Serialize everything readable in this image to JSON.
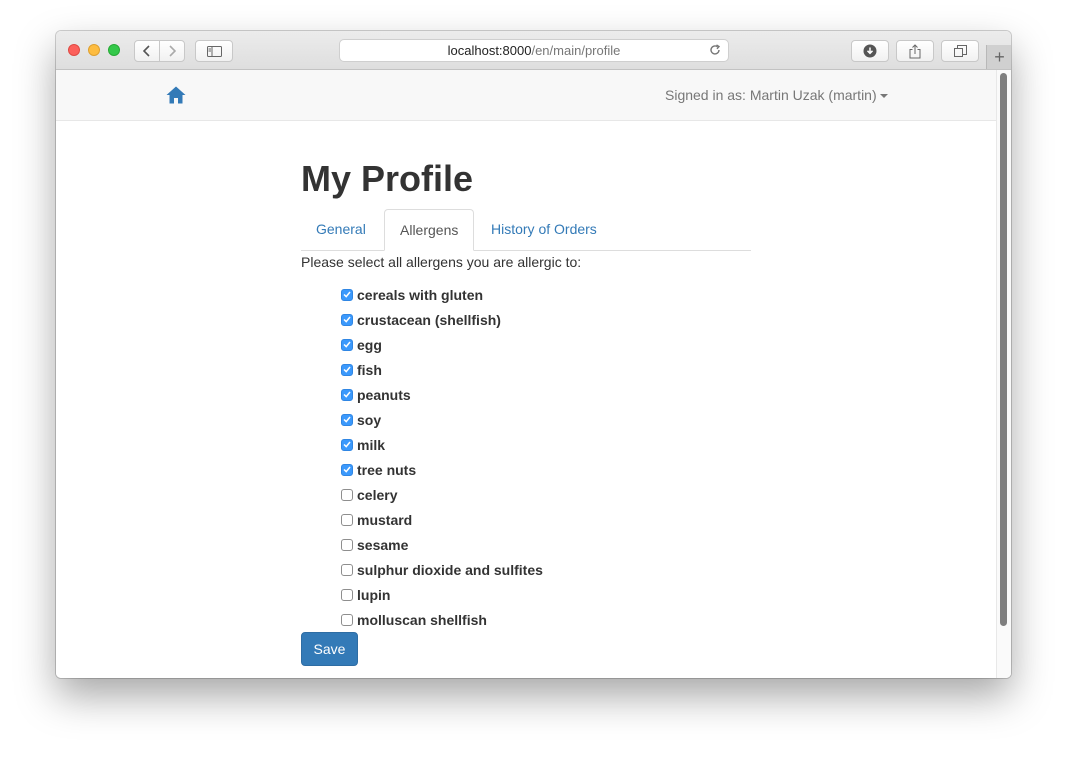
{
  "browser": {
    "url_host": "localhost:8000",
    "url_path": "/en/main/profile",
    "new_tab_label": "+"
  },
  "navbar": {
    "home_icon": "home-icon",
    "signed_in_text": "Signed in as: Martin Uzak (martin)"
  },
  "page": {
    "title": "My Profile",
    "tabs": [
      {
        "label": "General",
        "active": false
      },
      {
        "label": "Allergens",
        "active": true
      },
      {
        "label": "History of Orders",
        "active": false
      }
    ],
    "prompt": "Please select all allergens you are allergic to:",
    "allergens": [
      {
        "label": "cereals with gluten",
        "checked": true
      },
      {
        "label": "crustacean (shellfish)",
        "checked": true
      },
      {
        "label": "egg",
        "checked": true
      },
      {
        "label": "fish",
        "checked": true
      },
      {
        "label": "peanuts",
        "checked": true
      },
      {
        "label": "soy",
        "checked": true
      },
      {
        "label": "milk",
        "checked": true
      },
      {
        "label": "tree nuts",
        "checked": true
      },
      {
        "label": "celery",
        "checked": false
      },
      {
        "label": "mustard",
        "checked": false
      },
      {
        "label": "sesame",
        "checked": false
      },
      {
        "label": "sulphur dioxide and sulfites",
        "checked": false
      },
      {
        "label": "lupin",
        "checked": false
      },
      {
        "label": "molluscan shellfish",
        "checked": false
      }
    ],
    "save_label": "Save"
  },
  "colors": {
    "link": "#337ab7",
    "primary_button": "#337ab7",
    "checkbox_checked": "#3b99fc",
    "text": "#333333",
    "navbar_text": "#777777"
  }
}
